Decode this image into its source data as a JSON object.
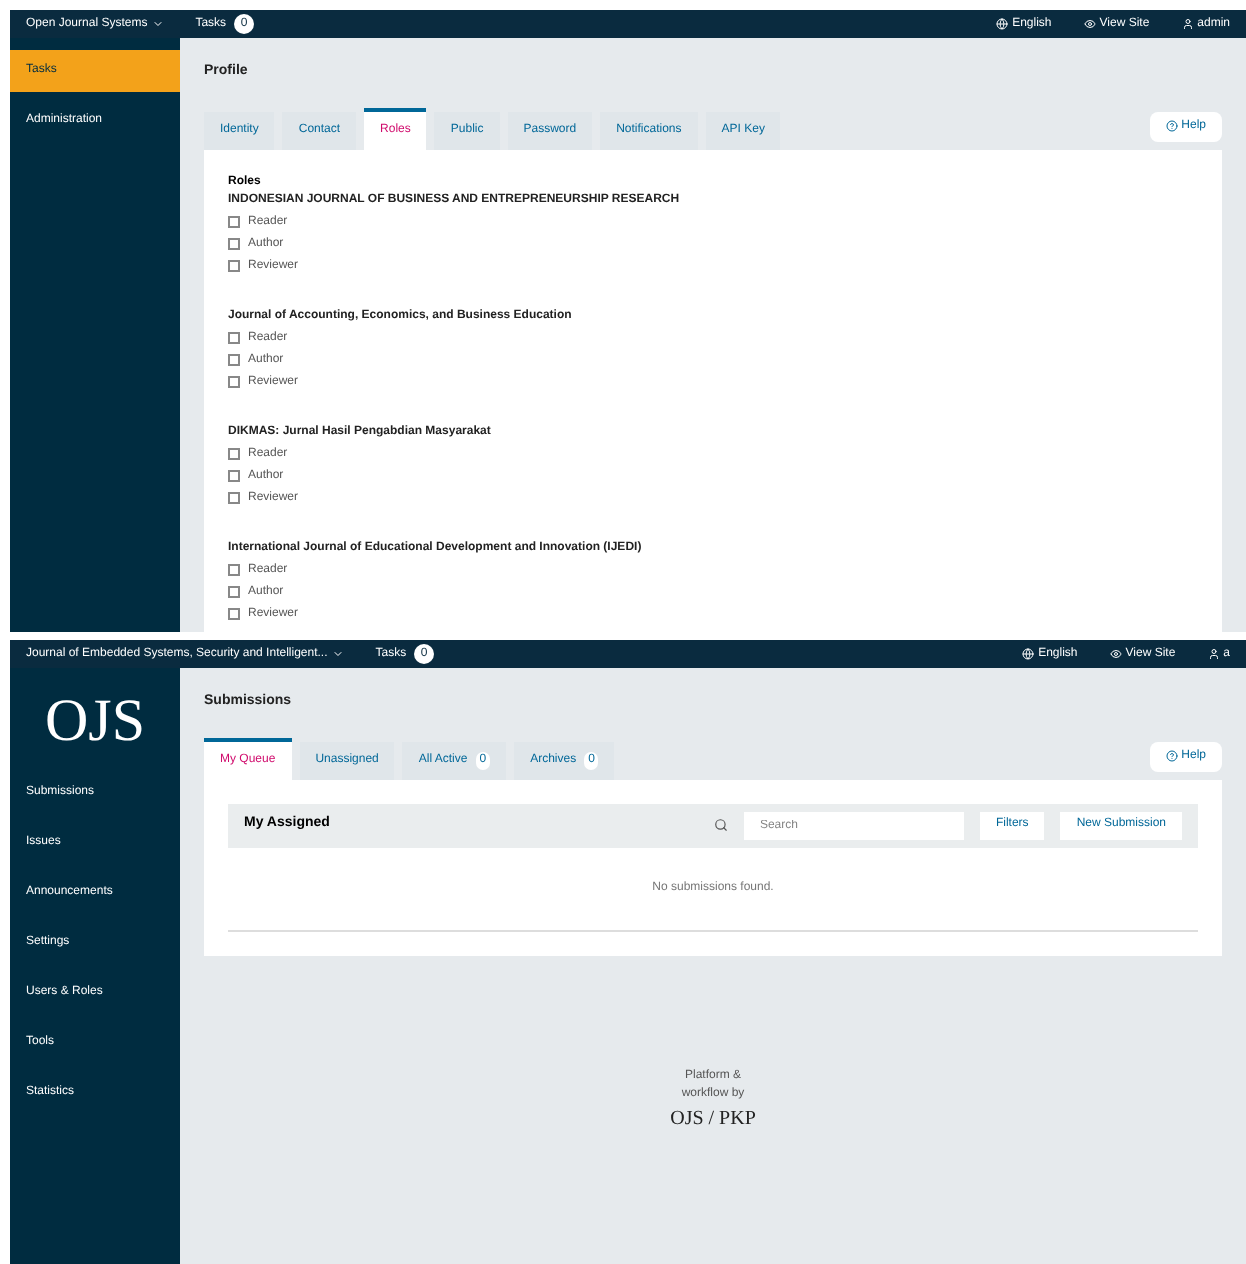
{
  "profile_screen": {
    "topbar": {
      "context": "Open Journal Systems",
      "tasks_label": "Tasks",
      "tasks_count": "0",
      "language": "English",
      "view_site": "View Site",
      "user": "admin"
    },
    "sidebar": {
      "items": [
        {
          "label": "Tasks",
          "selected": true
        },
        {
          "label": "Administration",
          "selected": false
        }
      ]
    },
    "title": "Profile",
    "tabs": [
      {
        "label": "Identity",
        "selected": false
      },
      {
        "label": "Contact",
        "selected": false
      },
      {
        "label": "Roles",
        "selected": true
      },
      {
        "label": "Public",
        "selected": false
      },
      {
        "label": "Password",
        "selected": false
      },
      {
        "label": "Notifications",
        "selected": false
      },
      {
        "label": "API Key",
        "selected": false
      }
    ],
    "help": "Help",
    "section_title": "Roles",
    "journals": [
      {
        "name": "INDONESIAN JOURNAL OF BUSINESS AND ENTREPRENEURSHIP RESEARCH",
        "roles": [
          {
            "label": "Reader",
            "checked": false
          },
          {
            "label": "Author",
            "checked": false
          },
          {
            "label": "Reviewer",
            "checked": false
          }
        ]
      },
      {
        "name": "Journal of Accounting, Economics, and Business Education",
        "roles": [
          {
            "label": "Reader",
            "checked": false
          },
          {
            "label": "Author",
            "checked": false
          },
          {
            "label": "Reviewer",
            "checked": false
          }
        ]
      },
      {
        "name": "DIKMAS: Jurnal Hasil Pengabdian Masyarakat",
        "roles": [
          {
            "label": "Reader",
            "checked": false
          },
          {
            "label": "Author",
            "checked": false
          },
          {
            "label": "Reviewer",
            "checked": false
          }
        ]
      },
      {
        "name": "International Journal of Educational Development and Innovation (IJEDI)",
        "roles": [
          {
            "label": "Reader",
            "checked": false
          },
          {
            "label": "Author",
            "checked": false
          },
          {
            "label": "Reviewer",
            "checked": false
          }
        ]
      }
    ]
  },
  "submissions_screen": {
    "topbar": {
      "context": "Journal of Embedded Systems, Security and Intelligent...",
      "tasks_label": "Tasks",
      "tasks_count": "0",
      "language": "English",
      "view_site": "View Site",
      "user": "a"
    },
    "logo": "OJS",
    "sidebar": {
      "items": [
        {
          "label": "Submissions",
          "selected": false
        },
        {
          "label": "Issues",
          "selected": false
        },
        {
          "label": "Announcements",
          "selected": false
        },
        {
          "label": "Settings",
          "selected": false
        },
        {
          "label": "Users & Roles",
          "selected": false
        },
        {
          "label": "Tools",
          "selected": false
        },
        {
          "label": "Statistics",
          "selected": false
        }
      ]
    },
    "title": "Submissions",
    "tabs": [
      {
        "label": "My Queue",
        "selected": true
      },
      {
        "label": "Unassigned",
        "selected": false
      },
      {
        "label": "All Active",
        "count": "0",
        "selected": false
      },
      {
        "label": "Archives",
        "count": "0",
        "selected": false
      }
    ],
    "help": "Help",
    "panel": {
      "title": "My Assigned",
      "search": {
        "placeholder": "Search"
      },
      "filters": "Filters",
      "new_submission": "New Submission",
      "empty": "No submissions found."
    },
    "footer": {
      "caption": "Platform & workflow by",
      "brand": "OJS / PKP"
    }
  }
}
